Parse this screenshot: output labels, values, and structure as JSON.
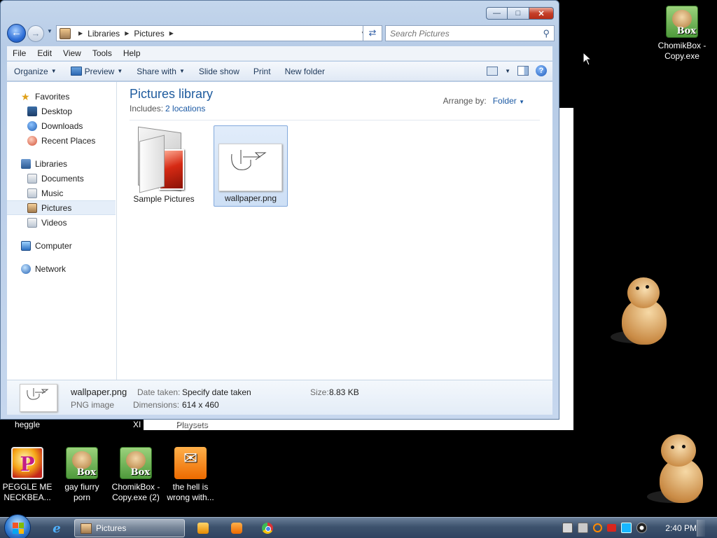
{
  "window": {
    "breadcrumb": [
      "Libraries",
      "Pictures"
    ],
    "search_placeholder": "Search Pictures",
    "menu": [
      "File",
      "Edit",
      "View",
      "Tools",
      "Help"
    ],
    "toolbar": {
      "organize": "Organize",
      "preview": "Preview",
      "share_with": "Share with",
      "slide_show": "Slide show",
      "print": "Print",
      "new_folder": "New folder"
    },
    "nav": {
      "favorites": "Favorites",
      "desktop": "Desktop",
      "downloads": "Downloads",
      "recent_places": "Recent Places",
      "libraries": "Libraries",
      "documents": "Documents",
      "music": "Music",
      "pictures": "Pictures",
      "videos": "Videos",
      "computer": "Computer",
      "network": "Network"
    },
    "library": {
      "title": "Pictures library",
      "includes_label": "Includes:",
      "includes_link": "2 locations",
      "arrange_label": "Arrange by:",
      "arrange_value": "Folder"
    },
    "files": [
      {
        "name": "Sample Pictures",
        "kind": "folder"
      },
      {
        "name": "wallpaper.png",
        "kind": "png",
        "selected": true
      }
    ],
    "details": {
      "name": "wallpaper.png",
      "type": "PNG image",
      "date_taken_label": "Date taken:",
      "date_taken_value": "Specify date taken",
      "dimensions_label": "Dimensions:",
      "dimensions_value": "614 x 460",
      "size_label": "Size:",
      "size_value": "8.83 KB"
    }
  },
  "desktop": {
    "strip_labels": [
      "heggle",
      "XI",
      "Playsets"
    ],
    "icons": [
      {
        "label": "ChomikBox - Copy.exe",
        "icon": "chomikbox-icon"
      },
      {
        "label": "PEGGLE ME NECKBEA...",
        "icon": "peggle-icon"
      },
      {
        "label": "gay fiurry porn",
        "icon": "chomikbox-icon"
      },
      {
        "label": "ChomikBox - Copy.exe (2)",
        "icon": "chomikbox-icon"
      },
      {
        "label": "the hell is wrong with...",
        "icon": "uc-browser-icon"
      }
    ]
  },
  "taskbar": {
    "active_task": "Pictures",
    "clock": "2:40 PM"
  }
}
